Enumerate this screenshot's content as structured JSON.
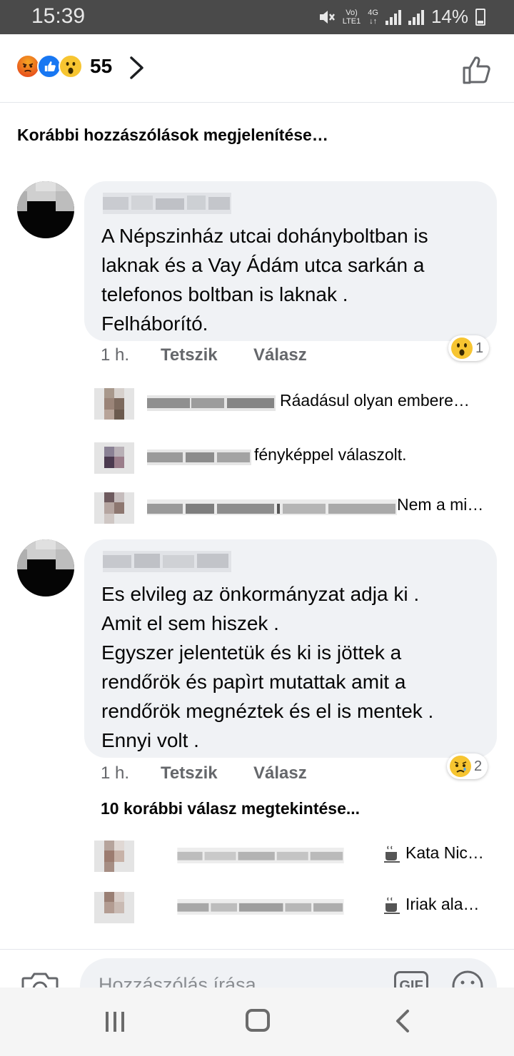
{
  "status_bar": {
    "time": "15:39",
    "network_top": "Vo)",
    "network_bottom": "LTE1",
    "net_type_top": "4G",
    "net_type_bottom": "↓↑",
    "battery": "14%"
  },
  "reactions": {
    "icons": [
      "angry-icon",
      "like-icon",
      "wow-icon"
    ],
    "count": "55"
  },
  "previous_comments_label": "Korábbi hozzászólások megjelenítése…",
  "comments": [
    {
      "text": "A Népszinház utcai dohányboltban is\nlaknak és a Vay Ádám utca sarkán a\ntelefonos boltban is laknak .\nFelháborító.",
      "time": "1 h.",
      "like_label": "Tetszik",
      "reply_label": "Válasz",
      "reaction_count": "1",
      "reaction_icon": "wow-icon",
      "replies": [
        {
          "text": "Ráadásul olyan embere…"
        },
        {
          "text": "fényképpel válaszolt."
        },
        {
          "text": "Nem a mi…"
        }
      ]
    },
    {
      "text": "Es elvileg az önkormányzat adja ki .\nAmit el sem hiszek .\nEgyszer jelentetük és ki is jöttek a\nrendőrök és papìrt mutattak amit a\nrendőrök megnéztek és el is mentek .\nEnnyi volt .",
      "time": "1 h.",
      "like_label": "Tetszik",
      "reply_label": "Válasz",
      "reaction_count": "2",
      "reaction_icon": "sad-icon",
      "view_more_label": "10 korábbi válasz megtekintése...",
      "replies": [
        {
          "text": "Kata Nic…",
          "icon": "coffee-icon"
        },
        {
          "text": "Iriak ala…",
          "icon": "coffee-icon"
        }
      ]
    }
  ],
  "composer": {
    "placeholder": "Hozzászólás írása…",
    "gif_label": "GIF"
  },
  "colors": {
    "bubble": "#f0f2f5",
    "meta": "#65676b",
    "like_blue": "#1877f2",
    "wow_yellow": "#f7c531"
  }
}
